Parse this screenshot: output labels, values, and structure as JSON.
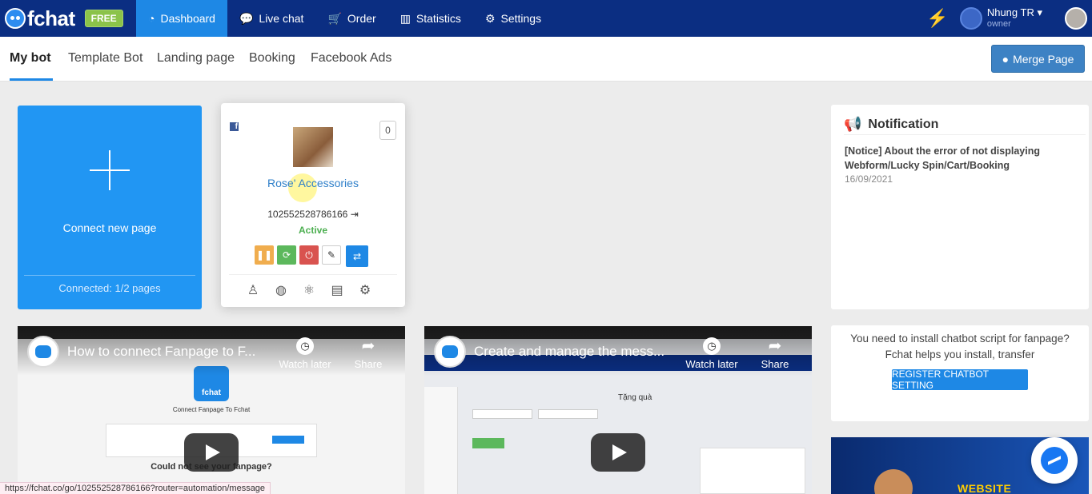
{
  "app": {
    "logo_text": "fchat",
    "plan_badge": "FREE"
  },
  "nav": {
    "items": [
      {
        "label": "Dashboard",
        "icon": "dashboard-icon",
        "active": true
      },
      {
        "label": "Live chat",
        "icon": "chat-icon"
      },
      {
        "label": "Order",
        "icon": "cart-icon"
      },
      {
        "label": "Statistics",
        "icon": "bar-chart-icon"
      },
      {
        "label": "Settings",
        "icon": "gear-icon"
      }
    ],
    "user": {
      "name": "Nhung TR",
      "role": "owner"
    }
  },
  "subnav": {
    "tabs": [
      "My bot",
      "Template Bot",
      "Landing page",
      "Booking",
      "Facebook Ads"
    ],
    "merge_label": "Merge Page"
  },
  "connect_card": {
    "label": "Connect new page",
    "count": "Connected: 1/2 pages"
  },
  "page_card": {
    "count": "0",
    "name": "Rose' Accessories",
    "id": "102552528786166",
    "status": "Active"
  },
  "notification": {
    "title": "Notification",
    "text": "[Notice] About the error of not displaying Webform/Lucky Spin/Cart/Booking",
    "date": "16/09/2021"
  },
  "install": {
    "line1": "You need to install chatbot script for fanpage?",
    "line2": "Fchat helps you install, transfer",
    "button": "REGISTER CHATBOT SETTING"
  },
  "ad": {
    "text": "WEBSITE AUTOMATION"
  },
  "videos": [
    {
      "title": "How to connect Fanpage to F...",
      "watch_later": "Watch later",
      "share": "Share",
      "app_name": "fchat",
      "heading": "Connect Fanpage To Fchat",
      "bottom": "Could not see your fanpage?"
    },
    {
      "title": "Create and manage the mess...",
      "watch_later": "Watch later",
      "share": "Share",
      "quote": "Tặng quà"
    }
  ],
  "status_url": "https://fchat.co/go/102552528786166?router=automation/message",
  "colors": {
    "nav": "#0b2e82",
    "accent": "#1e88e5",
    "active_status": "#4caf50"
  }
}
